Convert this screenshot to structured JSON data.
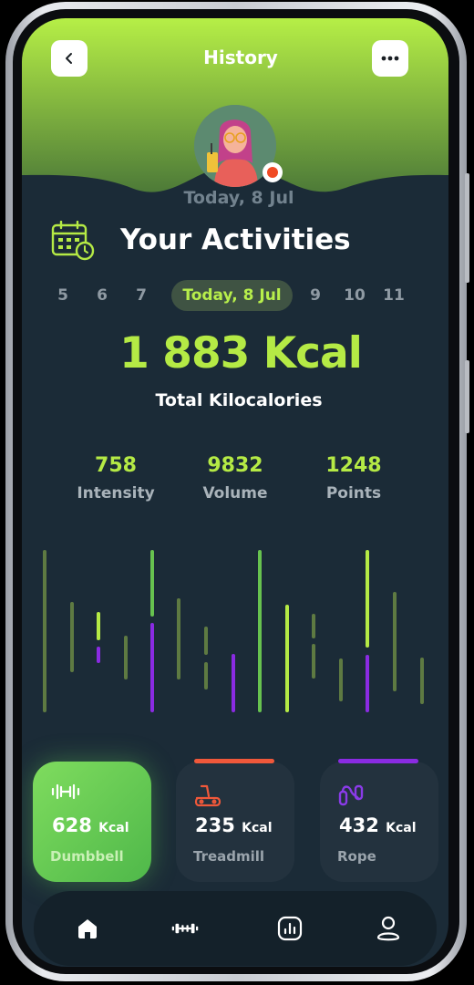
{
  "header": {
    "title": "History",
    "back_icon": "chevron-left-icon",
    "more_icon": "more-horizontal-icon"
  },
  "profile": {
    "date": "Today, 8 Jul",
    "status_color": "#f04a24"
  },
  "activities": {
    "title": "Your Activities",
    "icon": "calendar-clock-icon"
  },
  "days": [
    "5",
    "6",
    "7",
    "Today, 8 Jul",
    "9",
    "10",
    "11"
  ],
  "total": {
    "value": "1 883 Kcal",
    "label": "Total Kilocalories"
  },
  "stats": [
    {
      "value": "758",
      "label": "Intensity"
    },
    {
      "value": "9832",
      "label": "Volume"
    },
    {
      "value": "1248",
      "label": "Points"
    }
  ],
  "cards": [
    {
      "value": "628",
      "unit": "Kcal",
      "name": "Dumbbell",
      "icon": "dumbbell-icon"
    },
    {
      "value": "235",
      "unit": "Kcal",
      "name": "Treadmill",
      "icon": "treadmill-icon",
      "accent": "#f0583a"
    },
    {
      "value": "432",
      "unit": "Kcal",
      "name": "Rope",
      "icon": "jump-rope-icon",
      "accent": "#8a2be2"
    }
  ],
  "bottom_nav": [
    "home-icon",
    "dumbbell-icon",
    "stats-icon",
    "profile-icon"
  ],
  "colors": {
    "background": "#1b2b37",
    "accent_green": "#b5ea45",
    "accent_purple": "#8a2be2"
  }
}
